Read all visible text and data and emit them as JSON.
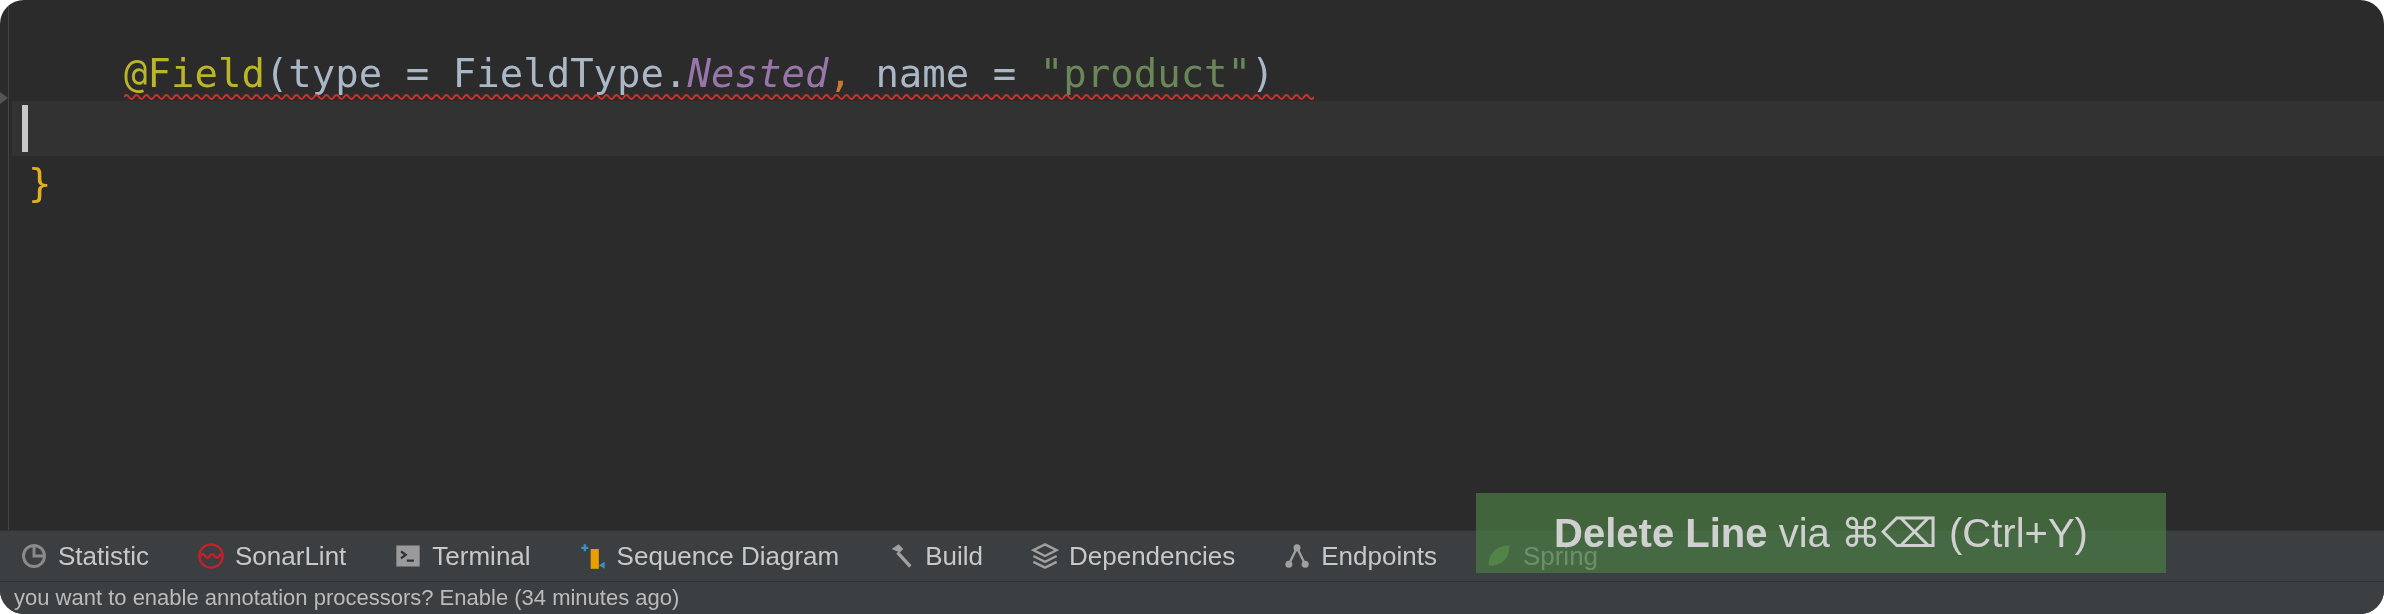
{
  "editor": {
    "lines": [
      {
        "current": false,
        "error": true,
        "tokens": [
          {
            "kind": "annotation",
            "text": "@Field"
          },
          {
            "kind": "plain",
            "text": "(type = FieldType."
          },
          {
            "kind": "constant",
            "text": "Nested"
          },
          {
            "kind": "comma",
            "text": ","
          },
          {
            "kind": "plain",
            "text": " name = "
          },
          {
            "kind": "string",
            "text": "\"product\""
          },
          {
            "kind": "plain",
            "text": ")"
          }
        ]
      },
      {
        "current": true,
        "error": false
      },
      {
        "current": false,
        "error": false,
        "tokens": [
          {
            "kind": "brace",
            "text": "}"
          }
        ]
      }
    ]
  },
  "tool_windows": [
    {
      "label": "Statistic"
    },
    {
      "label": "SonarLint"
    },
    {
      "label": "Terminal"
    },
    {
      "label": "Sequence Diagram"
    },
    {
      "label": "Build"
    },
    {
      "label": "Dependencies"
    },
    {
      "label": "Endpoints"
    },
    {
      "label": "Spring"
    }
  ],
  "hint_popup": {
    "text": "**Delete Line** via ⌘⌫ (Ctrl+Y)"
  },
  "status_bar": {
    "text": "you want to enable annotation processors? Enable (34 minutes ago)"
  }
}
